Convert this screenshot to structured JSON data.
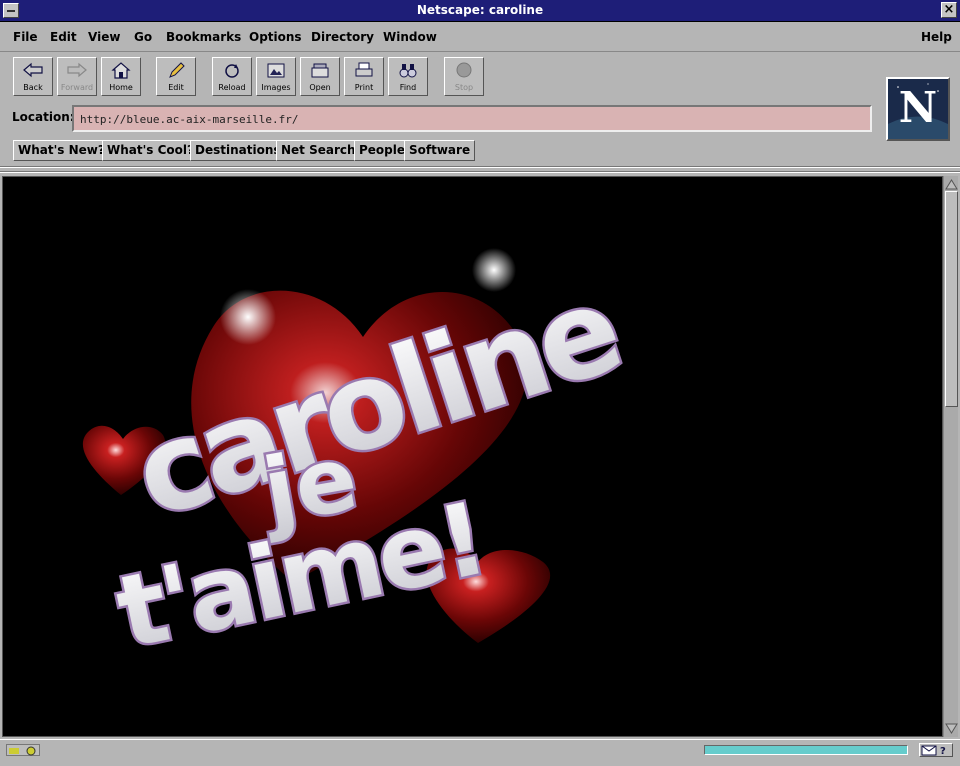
{
  "window": {
    "title": "Netscape: caroline"
  },
  "menu": {
    "items": [
      "File",
      "Edit",
      "View",
      "Go",
      "Bookmarks",
      "Options",
      "Directory",
      "Window"
    ],
    "help": "Help"
  },
  "toolbar": {
    "buttons": [
      {
        "label": "Back",
        "icon": "back-arrow-icon",
        "enabled": true
      },
      {
        "label": "Forward",
        "icon": "forward-arrow-icon",
        "enabled": false
      },
      {
        "label": "Home",
        "icon": "home-icon",
        "enabled": true
      },
      {
        "label": "Edit",
        "icon": "pencil-icon",
        "enabled": true
      },
      {
        "label": "Reload",
        "icon": "reload-icon",
        "enabled": true
      },
      {
        "label": "Images",
        "icon": "images-icon",
        "enabled": true
      },
      {
        "label": "Open",
        "icon": "open-icon",
        "enabled": true
      },
      {
        "label": "Print",
        "icon": "printer-icon",
        "enabled": true
      },
      {
        "label": "Find",
        "icon": "binoculars-icon",
        "enabled": true
      },
      {
        "label": "Stop",
        "icon": "stop-icon",
        "enabled": false
      }
    ]
  },
  "location": {
    "label": "Location:",
    "url": "http://bleue.ac-aix-marseille.fr/"
  },
  "directory_buttons": [
    "What's New?",
    "What's Cool?",
    "Destinations",
    "Net Search",
    "People",
    "Software"
  ],
  "content": {
    "background": "#000000",
    "artwork_text": [
      "caroline",
      "je",
      "t'aime!"
    ]
  },
  "status": {
    "progress": 1.0
  },
  "colors": {
    "titlebar": "#1e1e78",
    "chrome": "#b5b5b5",
    "location_field": "#d9b3b3",
    "progress_fill": "#66cccc"
  }
}
